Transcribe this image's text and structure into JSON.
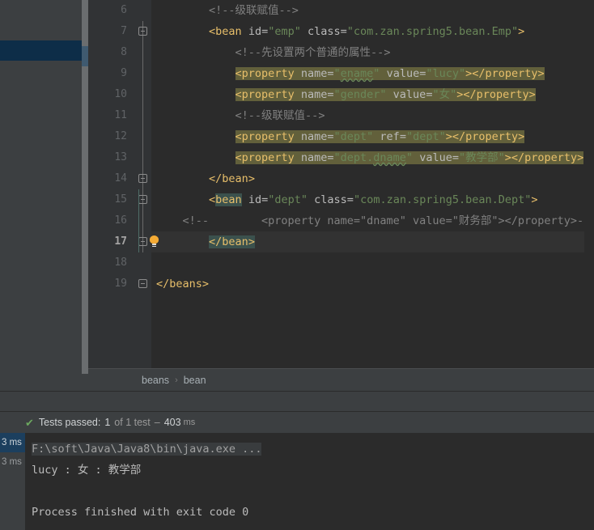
{
  "editor": {
    "first_line_number": 6,
    "current_line": 17,
    "breadcrumb": [
      "beans",
      "bean"
    ],
    "lines": [
      {
        "num": 6,
        "indent": 8,
        "fold": "none",
        "text": "<!--级联赋值-->"
      },
      {
        "num": 7,
        "indent": 8,
        "fold": "open",
        "text": "<bean id=\"emp\" class=\"com.zan.spring5.bean.Emp\">"
      },
      {
        "num": 8,
        "indent": 12,
        "fold": "none",
        "text": "<!--先设置两个普通的属性-->"
      },
      {
        "num": 9,
        "indent": 12,
        "fold": "none",
        "text": "<property name=\"ename\" value=\"lucy\"></property>"
      },
      {
        "num": 10,
        "indent": 12,
        "fold": "none",
        "text": "<property name=\"gender\" value=\"女\"></property>"
      },
      {
        "num": 11,
        "indent": 12,
        "fold": "none",
        "text": "<!--级联赋值-->"
      },
      {
        "num": 12,
        "indent": 12,
        "fold": "none",
        "text": "<property name=\"dept\" ref=\"dept\"></property>"
      },
      {
        "num": 13,
        "indent": 12,
        "fold": "none",
        "text": "<property name=\"dept.dname\" value=\"教学部\"></property>"
      },
      {
        "num": 14,
        "indent": 8,
        "fold": "close",
        "text": "</bean>"
      },
      {
        "num": 15,
        "indent": 8,
        "fold": "open",
        "text": "<bean id=\"dept\" class=\"com.zan.spring5.bean.Dept\">"
      },
      {
        "num": 16,
        "indent": 4,
        "fold": "none",
        "text": "<!--        <property name=\"dname\" value=\"财务部\"></property>-->"
      },
      {
        "num": 17,
        "indent": 8,
        "fold": "close",
        "text": "</bean>"
      },
      {
        "num": 18,
        "indent": 0,
        "fold": "none",
        "text": ""
      },
      {
        "num": 19,
        "indent": 0,
        "fold": "close",
        "text": "</beans>"
      }
    ]
  },
  "run_panel": {
    "status": {
      "icon": "check-icon",
      "label": "Tests passed:",
      "count": "1",
      "of_text": "of 1 test",
      "dash": "–",
      "time": "403",
      "unit": "ms"
    },
    "timings": [
      {
        "label": "3 ms",
        "selected": true
      },
      {
        "label": "3 ms",
        "selected": false
      }
    ],
    "console": [
      {
        "type": "cmd",
        "text": "F:\\soft\\Java\\Java8\\bin\\java.exe ..."
      },
      {
        "type": "out",
        "text": "lucy : 女 : 教学部"
      },
      {
        "type": "blank",
        "text": ""
      },
      {
        "type": "out",
        "text": "Process finished with exit code 0"
      }
    ]
  },
  "colors": {
    "editor_bg": "#2b2b2b",
    "panel_bg": "#3c3f41",
    "gutter_bg": "#313335",
    "tag": "#e8bf6a",
    "attr": "#bababa",
    "string": "#6a8759",
    "comment": "#808080",
    "property_highlight": "#62603b",
    "brace_highlight": "#3b514d",
    "selection_blue": "#0d2d48",
    "pass_green": "#6ca85f",
    "bulb_orange": "#f5ab35"
  }
}
